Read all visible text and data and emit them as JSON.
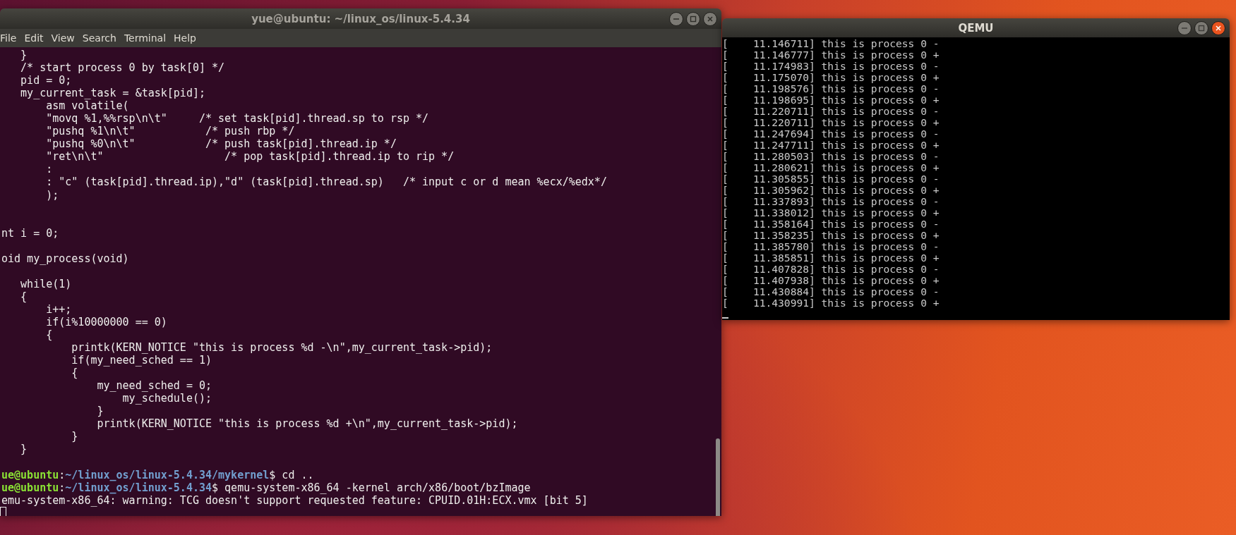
{
  "terminal": {
    "title": "yue@ubuntu: ~/linux_os/linux-5.4.34",
    "active": false,
    "menu": [
      "File",
      "Edit",
      "View",
      "Search",
      "Terminal",
      "Help"
    ],
    "lines": [
      {
        "kind": "code",
        "text": "   }"
      },
      {
        "kind": "code",
        "text": "   /* start process 0 by task[0] */"
      },
      {
        "kind": "code",
        "text": "   pid = 0;"
      },
      {
        "kind": "code",
        "text": "   my_current_task = &task[pid];"
      },
      {
        "kind": "code",
        "text": "       asm volatile("
      },
      {
        "kind": "code",
        "text": "       \"movq %1,%%rsp\\n\\t\"     /* set task[pid].thread.sp to rsp */"
      },
      {
        "kind": "code",
        "text": "       \"pushq %1\\n\\t\"           /* push rbp */"
      },
      {
        "kind": "code",
        "text": "       \"pushq %0\\n\\t\"           /* push task[pid].thread.ip */"
      },
      {
        "kind": "code",
        "text": "       \"ret\\n\\t\"                   /* pop task[pid].thread.ip to rip */"
      },
      {
        "kind": "code",
        "text": "       :"
      },
      {
        "kind": "code",
        "text": "       : \"c\" (task[pid].thread.ip),\"d\" (task[pid].thread.sp)   /* input c or d mean %ecx/%edx*/"
      },
      {
        "kind": "code",
        "text": "       );"
      },
      {
        "kind": "blank"
      },
      {
        "kind": "blank"
      },
      {
        "kind": "code",
        "text": "nt i = 0;"
      },
      {
        "kind": "blank"
      },
      {
        "kind": "code",
        "text": "oid my_process(void)"
      },
      {
        "kind": "blank"
      },
      {
        "kind": "code",
        "text": "   while(1)"
      },
      {
        "kind": "code",
        "text": "   {"
      },
      {
        "kind": "code",
        "text": "       i++;"
      },
      {
        "kind": "code",
        "text": "       if(i%10000000 == 0)"
      },
      {
        "kind": "code",
        "text": "       {"
      },
      {
        "kind": "code",
        "text": "           printk(KERN_NOTICE \"this is process %d -\\n\",my_current_task->pid);"
      },
      {
        "kind": "code",
        "text": "           if(my_need_sched == 1)"
      },
      {
        "kind": "code",
        "text": "           {"
      },
      {
        "kind": "code",
        "text": "               my_need_sched = 0;"
      },
      {
        "kind": "code",
        "text": "                   my_schedule();"
      },
      {
        "kind": "code",
        "text": "               }"
      },
      {
        "kind": "code",
        "text": "               printk(KERN_NOTICE \"this is process %d +\\n\",my_current_task->pid);"
      },
      {
        "kind": "code",
        "text": "           }"
      },
      {
        "kind": "code",
        "text": "   }"
      },
      {
        "kind": "blank"
      },
      {
        "kind": "prompt",
        "user": "ue@ubuntu",
        "sep": ":",
        "path": "~/linux_os/linux-5.4.34/mykernel",
        "command": "$ cd .."
      },
      {
        "kind": "prompt",
        "user": "ue@ubuntu",
        "sep": ":",
        "path": "~/linux_os/linux-5.4.34",
        "command": "$ qemu-system-x86_64 -kernel arch/x86/boot/bzImage"
      },
      {
        "kind": "code",
        "text": "emu-system-x86_64: warning: TCG doesn't support requested feature: CPUID.01H:ECX.vmx [bit 5]"
      },
      {
        "kind": "cursor"
      }
    ]
  },
  "qemu": {
    "title": "QEMU",
    "active": true,
    "lines": [
      "[    11.146711] this is process 0 -",
      "[    11.146777] this is process 0 +",
      "[    11.174983] this is process 0 -",
      "[    11.175070] this is process 0 +",
      "[    11.198576] this is process 0 -",
      "[    11.198695] this is process 0 +",
      "[    11.220711] this is process 0 -",
      "[    11.220711] this is process 0 +",
      "[    11.247694] this is process 0 -",
      "[    11.247711] this is process 0 +",
      "[    11.280503] this is process 0 -",
      "[    11.280621] this is process 0 +",
      "[    11.305855] this is process 0 -",
      "[    11.305962] this is process 0 +",
      "[    11.337893] this is process 0 -",
      "[    11.338012] this is process 0 +",
      "[    11.358164] this is process 0 -",
      "[    11.358235] this is process 0 +",
      "[    11.385780] this is process 0 -",
      "[    11.385851] this is process 0 +",
      "[    11.407828] this is process 0 -",
      "[    11.407938] this is process 0 +",
      "[    11.430884] this is process 0 -",
      "[    11.430991] this is process 0 +"
    ]
  }
}
